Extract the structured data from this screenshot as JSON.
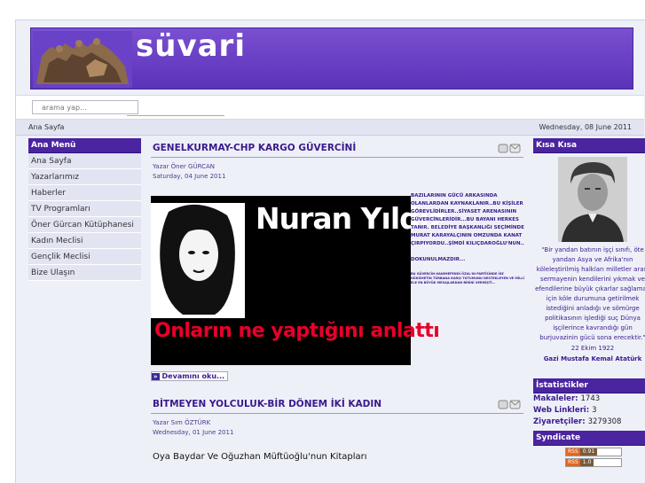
{
  "header": {
    "site_title": "süvari"
  },
  "search": {
    "placeholder": "arama yap..."
  },
  "breadcrumb": "Ana Sayfa",
  "date": "Wednesday, 08 June 2011",
  "main_menu": {
    "title": "Ana Menü",
    "items": [
      "Ana Sayfa",
      "Yazarlarımız",
      "Haberler",
      "TV Programları",
      "Öner Gürcan Kütüphanesi",
      "Kadın Meclisi",
      "Gençlik Meclisi",
      "Bize Ulaşın"
    ]
  },
  "articles": [
    {
      "title": "GENELKURMAY-CHP KARGO GÜVERCİNİ",
      "author": "Yazar Öner GÜRCAN",
      "date": "Saturday, 04 June 2011",
      "image_headline": "Nuran Yıldız",
      "image_caption": "Onların ne yaptığını anlattı",
      "summary_1": "BAZILARININ GÜCÜ ARKASINDA OLANLARDAN KAYNAKLANIR..BU KİŞİLER GÖREVLİDİRLER..SİYASET ARENASININ GÜVERCİNLERİDİR...BU BAYANI HERKES TANIR. BELEDİYE BAŞKANLIĞI SEÇİMİNDE MURAT KARAYALÇININ OMZUNDA KANAT ÇIRPIYORDU..ŞİMDİ KILIÇDAROĞLU'NUN..",
      "summary_2": "DOKUNULMAZDIR...",
      "summary_3": "BU GÜVERCİN HANIMEFENDİ ÖZAL'IN PARTİSİNDE İSE HÜKÜMETİN TÜRBANA KARŞI TUTUMUNU DESTEKLEYEN VE MİLLİ ELE EN BÜYÜK MESAJLARDAN BİRİNİ VERMİŞTİ...",
      "read_more": "Devamını oku..."
    },
    {
      "title": "BİTMEYEN YOLCULUK-BİR DÖNEM İKİ KADIN",
      "author": "Yazar Sım ÖZTÜRK",
      "date": "Wednesday, 01 June 2011",
      "subtitle": "Oya Baydar Ve Oğuzhan Müftüoğlu'nun Kitapları"
    }
  ],
  "kisa_kisa": {
    "title": "Kısa Kısa",
    "quote": "\"Bir yandan batının işçi sınıfı, öte yandan Asya ve Afrika'nın köleleştirilmiş halkları milletler arası sermayenin kendilerini yıkmak ve efendilerine büyük çıkarlar sağlamak için köle durumuna getirilmek istediğini anladığı ve sömürge politikasının işlediği suç Dünya işçilerince kavrandığı gün burjuvazinin gücü sona erecektir.\"",
    "quote_date": "22 Ekim 1922",
    "author": "Gazi Mustafa Kemal Atatürk"
  },
  "stats": {
    "title": "İstatistikler",
    "rows": [
      {
        "label": "Makaleler:",
        "value": "1743"
      },
      {
        "label": "Web Linkleri:",
        "value": "3"
      },
      {
        "label": "Ziyaretçiler:",
        "value": "3279308"
      }
    ]
  },
  "syndicate": {
    "title": "Syndicate",
    "feeds": [
      {
        "badge": "RSS",
        "version": "0.91"
      },
      {
        "badge": "RSS",
        "version": "1.0"
      }
    ]
  },
  "colors": {
    "accent": "#4b24a0",
    "header": "#6a42c8",
    "link": "#3a1a8c",
    "background": "#eef0f8"
  }
}
